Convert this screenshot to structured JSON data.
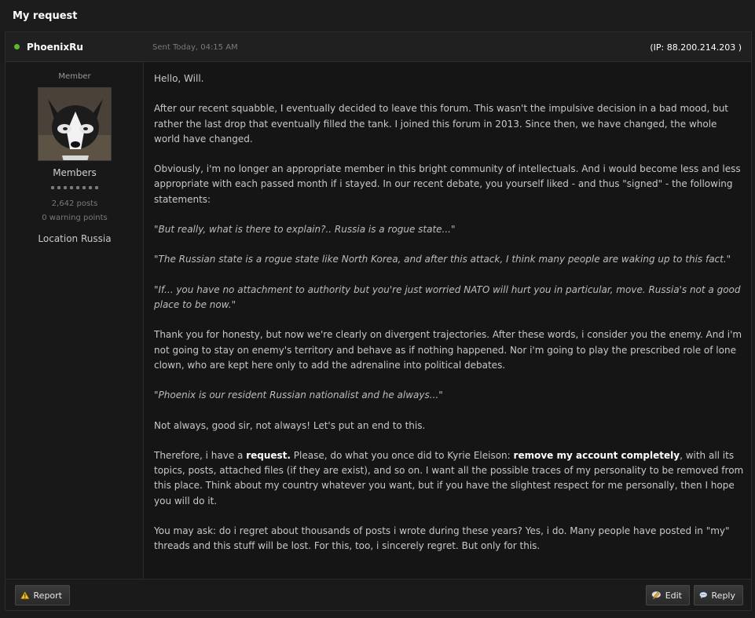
{
  "page": {
    "title": "My request"
  },
  "post": {
    "author": "PhoenixRu",
    "sent": "Sent Today, 04:15 AM",
    "ip": "(IP: 88.200.214.203 )",
    "author_info": {
      "member_title": "Member",
      "group": "Members",
      "pips": 8,
      "posts": "2,642 posts",
      "warning_points": "0 warning points",
      "location": "Location Russia"
    },
    "body": {
      "p1": "Hello, Will.",
      "p2": "After our recent squabble, I eventually decided to leave this forum. This wasn't the impulsive decision in a bad mood, but rather the last drop that eventually filled the tank. I joined this forum in 2013. Since then, we have changed, the whole world have changed.",
      "p3": "Obviously, i'm no longer an appropriate member in this bright community of intellectuals. And i would become less and less appropriate with each passed month if i stayed. In our recent debate, you yourself liked - and thus \"signed\" - the following statements:",
      "q1": "\"But really, what is there to explain?..  Russia is a rogue state...\"",
      "q2": "\"The Russian state is a rogue state like North Korea, and after this attack, I think many people are waking up to this fact.\"",
      "q3": "\"If... you have no attachment to authority but you're just worried NATO will hurt you in particular, move. Russia's not a good place to be now.\"",
      "p4": "Thank you for honesty, but now we're clearly on divergent trajectories. After these words, i consider you the enemy. And i'm not going to stay on enemy's territory and behave as if nothing happened. Nor i'm going to play the prescribed role of lone clown, who are kept here only to add the adrenaline into political debates.",
      "q4": "\"Phoenix is our resident Russian nationalist and he always...\"",
      "p5": "Not always, good sir, not always! Let's put an end to this.",
      "p6_a": "Therefore, i have a ",
      "p6_b": "request.",
      "p6_c": " Please, do what you once did to Kyrie Eleison: ",
      "p6_d": "remove my account completely",
      "p6_e": ", with all its topics, posts, attached files (if they are exist), and so on. I want all the possible traces of my personality to be removed from this place. Think about my country whatever you want, but if you have the slightest respect for me personally, then I hope you will do it.",
      "p7": "You may ask: do i regret about thousands of posts i wrote during these years? Yes, i do. Many people have posted in \"my\" threads and this stuff will be lost. For this, too, i sincerely regret. But only for this."
    }
  },
  "footer": {
    "report_label": "Report",
    "edit_label": "Edit",
    "reply_label": "Reply",
    "icons": {
      "report": "warning-icon",
      "edit": "edit-bubble-icon",
      "reply": "reply-bubble-icon"
    }
  },
  "colors": {
    "online": "#5cb82c",
    "background": "#1b1b1b"
  }
}
